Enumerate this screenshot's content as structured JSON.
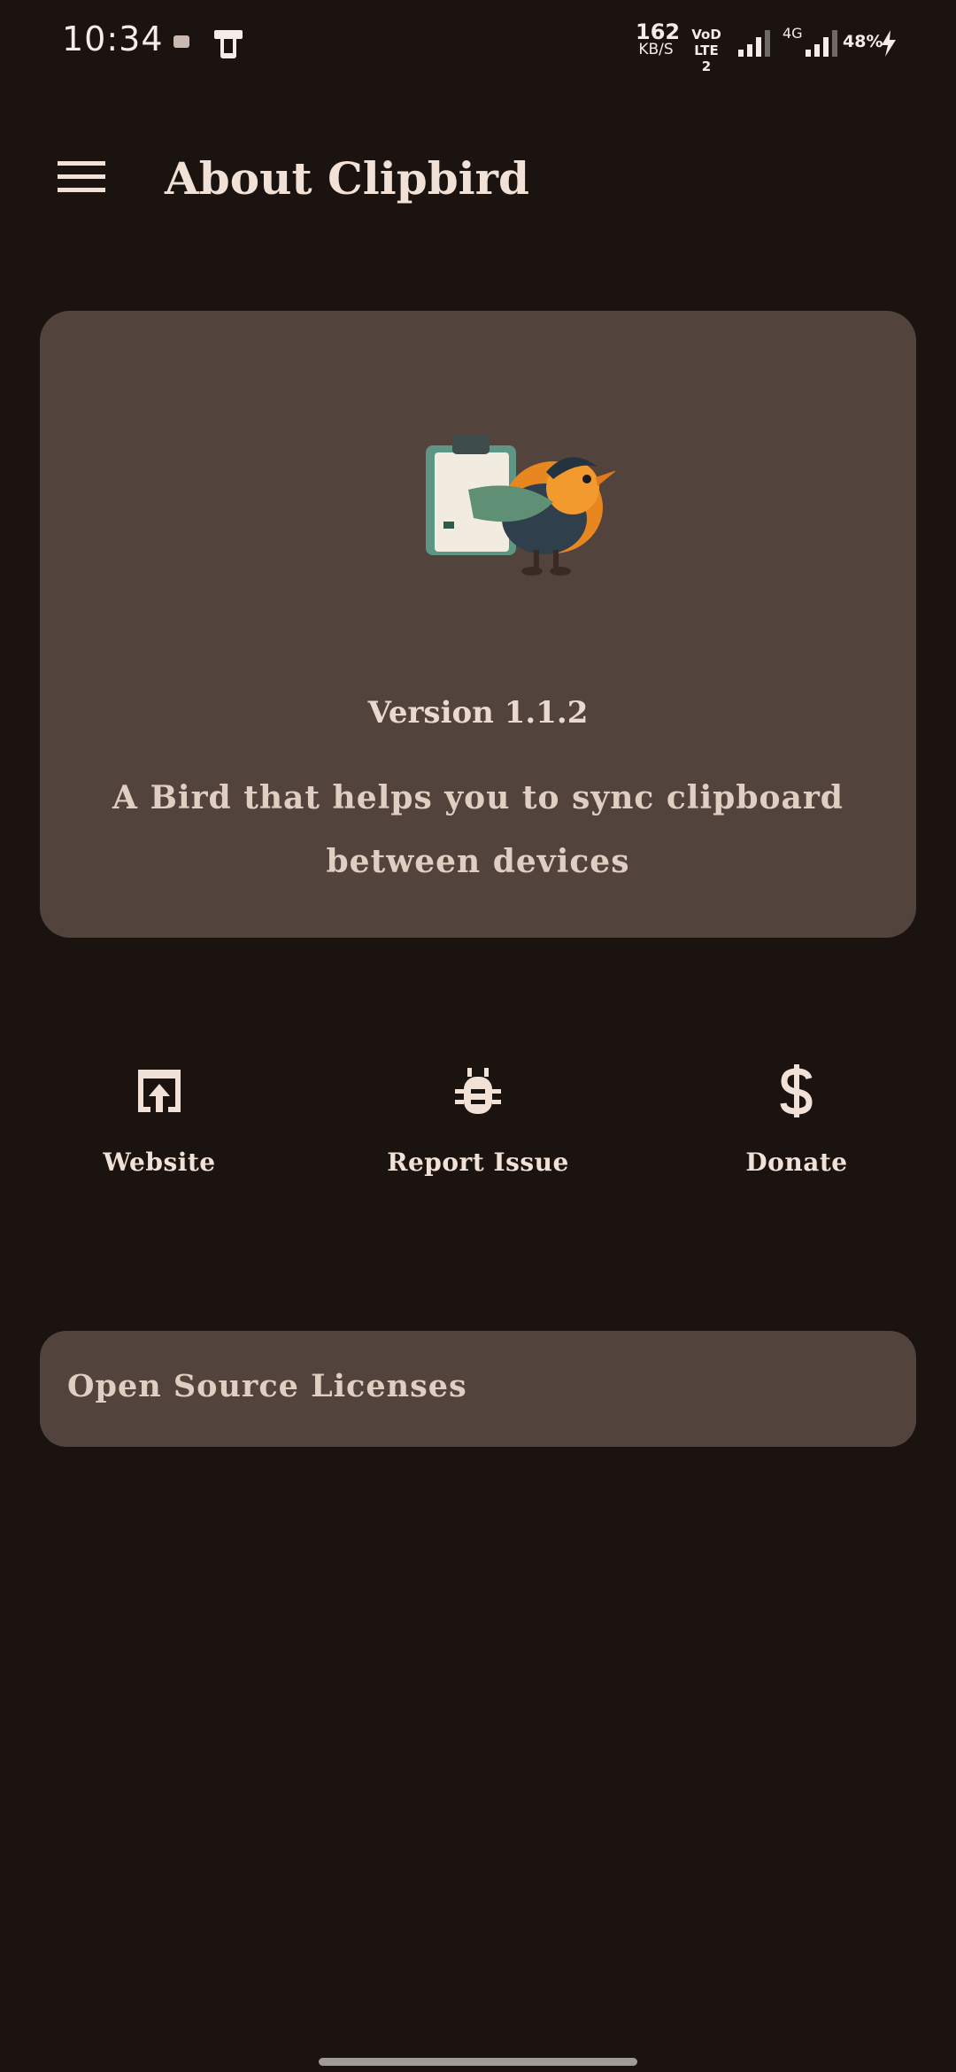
{
  "status_bar": {
    "time": "10:34",
    "net_speed_value": "162",
    "net_speed_unit": "KB/S",
    "volte_top": "VoD",
    "volte_bottom": "LTE 2",
    "network_type": "4G",
    "battery": "48%",
    "icons": [
      "notification-icon",
      "phone-icon",
      "signal-icon",
      "signal-icon",
      "charging-icon"
    ]
  },
  "app_bar": {
    "title": "About Clipbird",
    "menu_icon": "hamburger-menu-icon"
  },
  "info_card": {
    "logo": "clipbird-logo",
    "version": "Version 1.1.2",
    "tagline": "A Bird that helps you to sync clipboard between devices"
  },
  "actions": [
    {
      "label": "Website",
      "icon": "open-in-browser-icon"
    },
    {
      "label": "Report Issue",
      "icon": "bug-icon"
    },
    {
      "label": "Donate",
      "icon": "dollar-icon"
    }
  ],
  "licenses": {
    "label": "Open Source Licenses"
  },
  "colors": {
    "background": "#1a1310",
    "surface": "#52443c",
    "on_surface": "#f1e1d7",
    "accent_bird": "#f0902a"
  }
}
